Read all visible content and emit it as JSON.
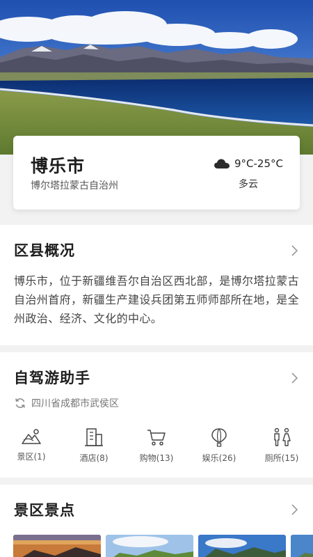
{
  "city": {
    "name": "博乐市",
    "prefecture": "博尔塔拉蒙古自治州",
    "temperature": "9°C-25°C",
    "weather": "多云",
    "weather_icon": "cloud-icon"
  },
  "overview": {
    "title": "区县概况",
    "text": "博乐市，位于新疆维吾尔自治区西北部，是博尔塔拉蒙古自治州首府，新疆生产建设兵团第五师师部所在地，是全州政治、经济、文化的中心。"
  },
  "drive_assistant": {
    "title": "自驾游助手",
    "location": "四川省成都市武侯区",
    "categories": [
      {
        "label": "景区(1)",
        "icon": "mountain-icon"
      },
      {
        "label": "酒店(8)",
        "icon": "hotel-icon"
      },
      {
        "label": "购物(13)",
        "icon": "cart-icon"
      },
      {
        "label": "娱乐(26)",
        "icon": "balloon-icon"
      },
      {
        "label": "厕所(15)",
        "icon": "restroom-icon"
      }
    ]
  },
  "scenic": {
    "title": "景区景点"
  },
  "colors": {
    "accent_text": "#1e1e1e",
    "secondary_text": "#555555",
    "background": "#f2f2f2",
    "lake": "#12357a",
    "sky": "#2f63bf"
  }
}
